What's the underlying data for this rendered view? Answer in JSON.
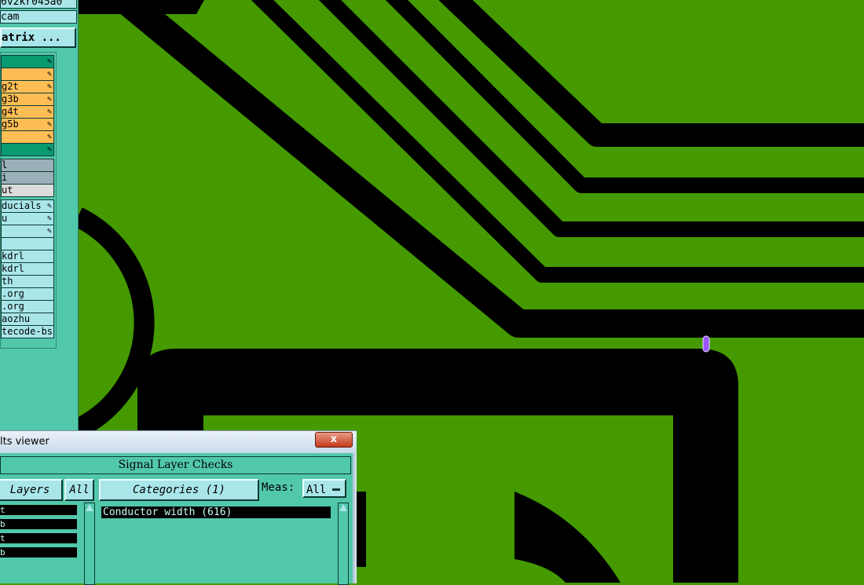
{
  "side_panel": {
    "job_name": "6v2kr045a0",
    "app_name": "cam",
    "matrix_button": "atrix ...",
    "layers": [
      {
        "label": "",
        "color": "green"
      },
      {
        "label": "",
        "color": "orange"
      },
      {
        "label": "g2t",
        "color": "orange"
      },
      {
        "label": "g3b",
        "color": "orange"
      },
      {
        "label": "g4t",
        "color": "orange"
      },
      {
        "label": "g5b",
        "color": "orange"
      },
      {
        "label": "",
        "color": "orange"
      },
      {
        "label": "",
        "color": "green"
      },
      {
        "label": "l",
        "color": "gray"
      },
      {
        "label": "i",
        "color": "gray"
      },
      {
        "label": "ut",
        "color": "lightgray"
      },
      {
        "label": "ducials",
        "color": "cyan"
      },
      {
        "label": "u",
        "color": "cyan"
      },
      {
        "label": "",
        "color": "cyan"
      },
      {
        "label": "",
        "color": "cyan"
      },
      {
        "label": "kdrl",
        "color": "cyan"
      },
      {
        "label": "kdrl",
        "color": "cyan"
      },
      {
        "label": "th",
        "color": "cyan"
      },
      {
        "label": ".org",
        "color": "cyan"
      },
      {
        "label": ".org",
        "color": "cyan"
      },
      {
        "label": "aozhu",
        "color": "cyan"
      },
      {
        "label": "tecode-bs",
        "color": "cyan"
      }
    ]
  },
  "viewer": {
    "title": "lts viewer",
    "close_label": "x",
    "header": "Signal Layer Checks",
    "layers_button": "Layers",
    "all_button": "All",
    "categories_button": "Categories (1)",
    "meas_label": "Meas:",
    "meas_value": "All",
    "layer_list": [
      "t",
      "b",
      "t",
      "b"
    ],
    "category_items": [
      "Conductor width (616)"
    ]
  },
  "colors": {
    "board_green": "#449a00",
    "copper_black": "#000000",
    "panel_teal": "#52c8aa",
    "marker_purple": "#9b55ff"
  }
}
